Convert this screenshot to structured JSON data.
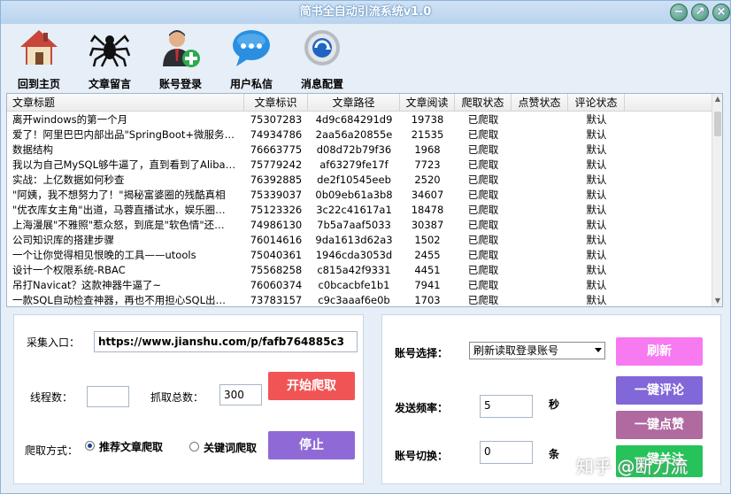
{
  "app": {
    "title": "简书全自动引流系统v1.0"
  },
  "window_buttons": {
    "minimize": "−",
    "pin": "↗",
    "close": "×"
  },
  "toolbar": [
    {
      "label": "回到主页",
      "icon": "house-icon"
    },
    {
      "label": "文章留言",
      "icon": "spider-icon"
    },
    {
      "label": "账号登录",
      "icon": "user-add-icon"
    },
    {
      "label": "用户私信",
      "icon": "chat-bubble-icon"
    },
    {
      "label": "消息配置",
      "icon": "settings-gear-icon"
    }
  ],
  "table": {
    "columns": [
      "文章标题",
      "文章标识",
      "文章路径",
      "文章阅读",
      "爬取状态",
      "点赞状态",
      "评论状态"
    ],
    "rows": [
      [
        "离开windows的第一个月",
        "75307283",
        "4d9c684291d9",
        "19738",
        "已爬取",
        "",
        "默认"
      ],
      [
        "爱了！阿里巴巴内部出品\"SpringBoot+微服务…",
        "74934786",
        "2aa56a20855e",
        "21535",
        "已爬取",
        "",
        "默认"
      ],
      [
        "数据结构",
        "76663775",
        "d08d72b79f36",
        "1968",
        "已爬取",
        "",
        "默认"
      ],
      [
        "我以为自己MySQL够牛逼了，直到看到了Aliba…",
        "75779242",
        "af63279fe17f",
        "7723",
        "已爬取",
        "",
        "默认"
      ],
      [
        "实战：上亿数据如何秒查",
        "76392885",
        "de2f10545eeb",
        "2520",
        "已爬取",
        "",
        "默认"
      ],
      [
        "\"阿姨，我不想努力了！\"揭秘富婆圈的残酷真相",
        "75339037",
        "0b09eb61a3b8",
        "34607",
        "已爬取",
        "",
        "默认"
      ],
      [
        "\"优衣库女主角\"出道，马蓉直播试水，娱乐圈…",
        "75123326",
        "3c22c41617a1",
        "18478",
        "已爬取",
        "",
        "默认"
      ],
      [
        "上海漫展\"不雅照\"惹众怒，到底是\"软色情\"还…",
        "74986130",
        "7b5a7aaf5033",
        "30387",
        "已爬取",
        "",
        "默认"
      ],
      [
        "公司知识库的搭建步骤",
        "76014616",
        "9da1613d62a3",
        "1502",
        "已爬取",
        "",
        "默认"
      ],
      [
        "一个让你觉得相见恨晚的工具——utools",
        "75040361",
        "1946cda3053d",
        "2455",
        "已爬取",
        "",
        "默认"
      ],
      [
        "设计一个权限系统-RBAC",
        "75568258",
        "c815a42f9331",
        "4451",
        "已爬取",
        "",
        "默认"
      ],
      [
        "吊打Navicat？这款神器牛逼了~",
        "76060374",
        "c0bcacbfe1b1",
        "7941",
        "已爬取",
        "",
        "默认"
      ],
      [
        "一款SQL自动检查神器，再也不用担心SQL出…",
        "73783157",
        "c9c3aaaf6e0b",
        "1703",
        "已爬取",
        "",
        "默认"
      ]
    ]
  },
  "crawl": {
    "entry_label": "采集入口：",
    "entry_value": "https://www.jianshu.com/p/fafb764885c3",
    "threads_label": "线程数：",
    "threads_value": "",
    "total_label": "抓取总数：",
    "total_value": "300",
    "start_button": "开始爬取",
    "mode_label": "爬取方式：",
    "mode_recommend": "推荐文章爬取",
    "mode_keyword": "关键词爬取",
    "stop_button": "停止"
  },
  "account": {
    "select_label": "账号选择：",
    "select_value": "刷新读取登录账号",
    "refresh_button": "刷新",
    "freq_label": "发送频率：",
    "freq_value": "5",
    "freq_unit": "秒",
    "switch_label": "账号切换：",
    "switch_value": "0",
    "switch_unit": "条",
    "comment_button": "一键评论",
    "like_button": "一键点赞",
    "follow_button": "一键关注"
  },
  "watermark": "知乎 @断刀流",
  "colors": {
    "red_button": "#f05454",
    "purple_button": "#8f6ad6",
    "pink_button": "#f77af1",
    "blue_purple_button": "#8267d8",
    "mauve_button": "#b06aa0",
    "green_button": "#25c35a"
  }
}
